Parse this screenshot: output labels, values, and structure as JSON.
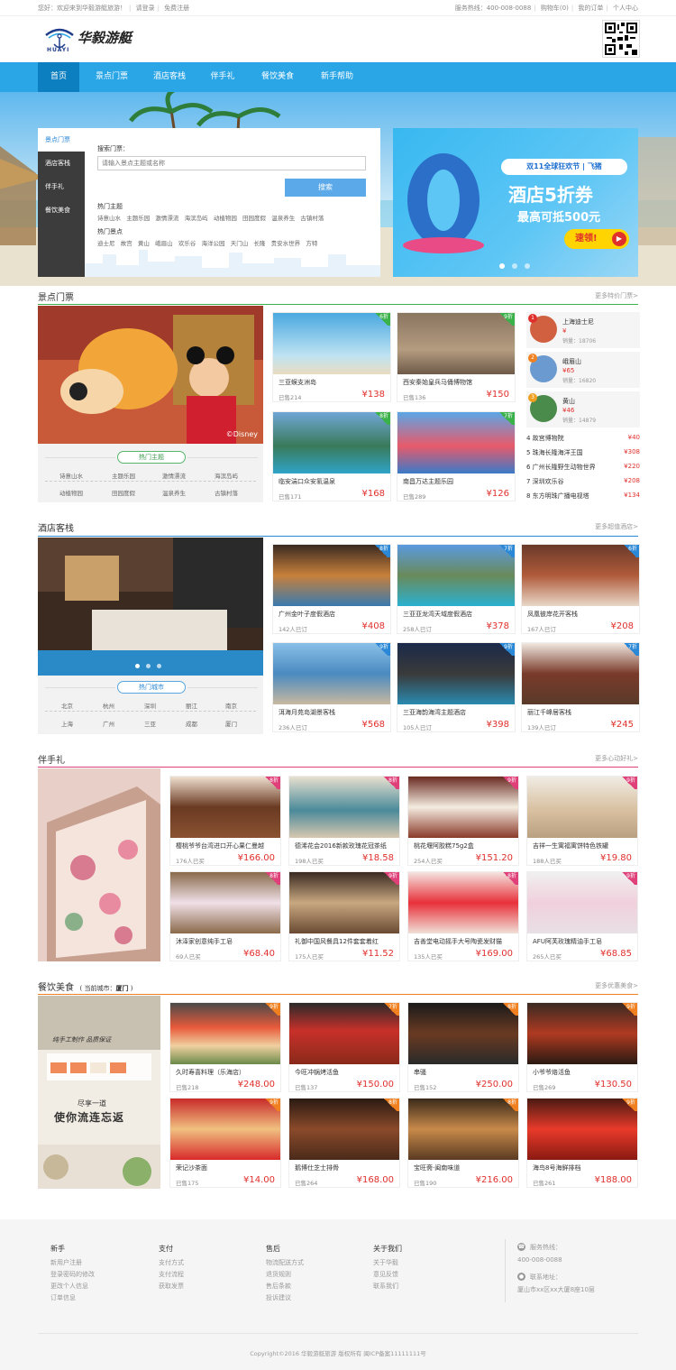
{
  "topbar": {
    "welcome": "您好：欢迎来到华毅游艇旅游！",
    "login": "请登录",
    "register": "免费注册",
    "hotline": "服务热线：400-008-0088",
    "cart": "购物车(0)",
    "orders": "我的订单",
    "center": "个人中心"
  },
  "logo": {
    "name": "华毅游艇",
    "sub": "HUAYI"
  },
  "nav": [
    "首页",
    "景点门票",
    "酒店客栈",
    "伴手礼",
    "餐饮美食",
    "新手帮助"
  ],
  "sidemenu": [
    "景点门票",
    "酒店客栈",
    "伴手礼",
    "餐饮美食"
  ],
  "search": {
    "label": "搜索门票：",
    "placeholder": "请输入景点主题或名称",
    "button": "搜索",
    "theme_title": "热门主题",
    "themes": [
      "诗意山水",
      "主题乐园",
      "激情漂流",
      "海滨岛屿",
      "动植物园",
      "田园度假",
      "温泉养生",
      "古镇村落"
    ],
    "spot_title": "热门景点",
    "spots": [
      "迪士尼",
      "故宫",
      "黄山",
      "峨眉山",
      "欢乐谷",
      "海洋公园",
      "天门山",
      "长隆",
      "贵安水世界",
      "方特"
    ]
  },
  "promo": {
    "line1": "双11全球狂欢节",
    "brand": "飞猪",
    "title": "酒店5折券",
    "sub": "最高可抵500元",
    "cta": "速领!"
  },
  "tickets": {
    "title": "景点门票",
    "more": "更多特价门票>",
    "hot_button": "热门主题",
    "themes": [
      "诗意山水",
      "主题乐园",
      "激情漂流",
      "海滨岛屿",
      "动植物园",
      "田园度假",
      "温泉养生",
      "古镇村落"
    ],
    "watermark": "©Disney",
    "cards": [
      {
        "name": "三亚蜈支洲岛",
        "sold": "已售214",
        "price": "¥138",
        "badge": "6折"
      },
      {
        "name": "西安秦始皇兵马俑博物馆",
        "sold": "已售136",
        "price": "¥150",
        "badge": "9折"
      },
      {
        "name": "临安湍口众安氡温泉",
        "sold": "已售171",
        "price": "¥168",
        "badge": "8折"
      },
      {
        "name": "南昌万达主题乐园",
        "sold": "已售289",
        "price": "¥126",
        "badge": "7折"
      }
    ],
    "ranks_top": [
      {
        "no": "1",
        "name": "上海迪士尼",
        "price": "¥",
        "sold": "销量：18706"
      },
      {
        "no": "2",
        "name": "峨眉山",
        "price": "¥65",
        "sold": "销量：16820"
      },
      {
        "no": "3",
        "name": "黄山",
        "price": "¥46",
        "sold": "销量：14879"
      }
    ],
    "ranks": [
      {
        "name": "4 故宫博物院",
        "price": "¥40"
      },
      {
        "name": "5 珠海长隆海洋王国",
        "price": "¥308"
      },
      {
        "name": "6 广州长隆野生动物世界",
        "price": "¥220"
      },
      {
        "name": "7 深圳欢乐谷",
        "price": "¥208"
      },
      {
        "name": "8 东方明珠广播电视塔",
        "price": "¥134"
      }
    ]
  },
  "hotels": {
    "title": "酒店客栈",
    "more": "更多超值酒店>",
    "hot_button": "热门城市",
    "cities1": [
      "北京",
      "杭州",
      "深圳",
      "丽江",
      "南京"
    ],
    "cities2": [
      "上海",
      "广州",
      "三亚",
      "成都",
      "厦门"
    ],
    "cards": [
      {
        "name": "广州金叶子度假酒店",
        "sold": "142人已订",
        "price": "¥408",
        "badge": "8折"
      },
      {
        "name": "三亚亚龙湾天域度假酒店",
        "sold": "258人已订",
        "price": "¥378",
        "badge": "7折"
      },
      {
        "name": "凤凰彼岸花开客栈",
        "sold": "167人已订",
        "price": "¥208",
        "badge": "6折"
      },
      {
        "name": "洱海月苑岛湖景客栈",
        "sold": "236人已订",
        "price": "¥568",
        "badge": "9折"
      },
      {
        "name": "三亚海韵海湾主题酒店",
        "sold": "105人已订",
        "price": "¥398",
        "badge": "9折"
      },
      {
        "name": "丽江千峰居客栈",
        "sold": "139人已订",
        "price": "¥245",
        "badge": "7折"
      }
    ]
  },
  "gifts": {
    "title": "伴手礼",
    "more": "更多心动好礼>",
    "cards": [
      {
        "name": "樱桃爷爷台湾进口开心果仁曼越",
        "sold": "176人已买",
        "price": "¥166.00",
        "badge": "8折"
      },
      {
        "name": "德浠花会2016新款玫瑰花冠茶纸",
        "sold": "198人已买",
        "price": "¥18.58",
        "badge": "8折"
      },
      {
        "name": "桃花堰阿胶糕75g2盒",
        "sold": "254人已买",
        "price": "¥151.20",
        "badge": "9折"
      },
      {
        "name": "吉祥一生寓福寓饼特色铁罐",
        "sold": "188人已买",
        "price": "¥19.80",
        "badge": "9折"
      },
      {
        "name": "沐泽家创意纯手工皂",
        "sold": "69人已买",
        "price": "¥68.40",
        "badge": "8折"
      },
      {
        "name": "礼御中国风餐具12件套套着红",
        "sold": "175人已买",
        "price": "¥11.52",
        "badge": "9折"
      },
      {
        "name": "吉善堂电动摇手大号陶瓷发财猫",
        "sold": "135人已买",
        "price": "¥169.00",
        "badge": "8折"
      },
      {
        "name": "AFU阿芙玫瑰精油手工皂",
        "sold": "265人已买",
        "price": "¥68.85",
        "badge": "9折"
      }
    ]
  },
  "food": {
    "title": "餐饮美食",
    "city_label": "( 当前城市：",
    "city": "厦门",
    "city_end": " )",
    "more": "更多优惠美食>",
    "banner_text1": "纯手工制作 品质保证",
    "banner_text2": "尽享一道",
    "banner_text3": "使你流连忘返",
    "cards": [
      {
        "name": "久时寿喜料理（乐海店）",
        "sold": "已售218",
        "price": "¥248.00",
        "badge": "9折"
      },
      {
        "name": "今旺冲锅烤活鱼",
        "sold": "已售137",
        "price": "¥150.00",
        "badge": "7折"
      },
      {
        "name": "串骚",
        "sold": "已售152",
        "price": "¥250.00",
        "badge": "8折"
      },
      {
        "name": "小爷爷烙活鱼",
        "sold": "已售269",
        "price": "¥130.50",
        "badge": "9折"
      },
      {
        "name": "荣记沙茶面",
        "sold": "已售175",
        "price": "¥14.00",
        "badge": "9折"
      },
      {
        "name": "鹅博仕芝士排骨",
        "sold": "已售264",
        "price": "¥168.00",
        "badge": "8折"
      },
      {
        "name": "宝旺斋·闽南味道",
        "sold": "已售190",
        "price": "¥216.00",
        "badge": "8折"
      },
      {
        "name": "海鸟8号海鲜排档",
        "sold": "已售261",
        "price": "¥188.00",
        "badge": "9折"
      }
    ]
  },
  "footer": {
    "cols": [
      {
        "title": "新手",
        "items": [
          "新用户注册",
          "登录密码的修改",
          "更改个人信息",
          "订单信息"
        ]
      },
      {
        "title": "支付",
        "items": [
          "支付方式",
          "支付流程",
          "获取发票"
        ]
      },
      {
        "title": "售后",
        "items": [
          "物流配送方式",
          "退货规则",
          "售后条款",
          "投诉建议"
        ]
      },
      {
        "title": "关于我们",
        "items": [
          "关于华毅",
          "意见反馈",
          "联系我们"
        ]
      }
    ],
    "hotline_label": "服务热线：",
    "hotline": "400-008-0088",
    "address_label": "联系地址：",
    "address": "厦山市xx区xx大厦8座10层",
    "copyright": "Copyright©2016 华毅游艇旅游 版权所有   闽ICP备案11111111号"
  },
  "colors": {
    "nav": "#2aa5e6",
    "price": "#e0302c",
    "green": "#3bb14a",
    "pink": "#e0407a",
    "orange": "#f08020"
  }
}
